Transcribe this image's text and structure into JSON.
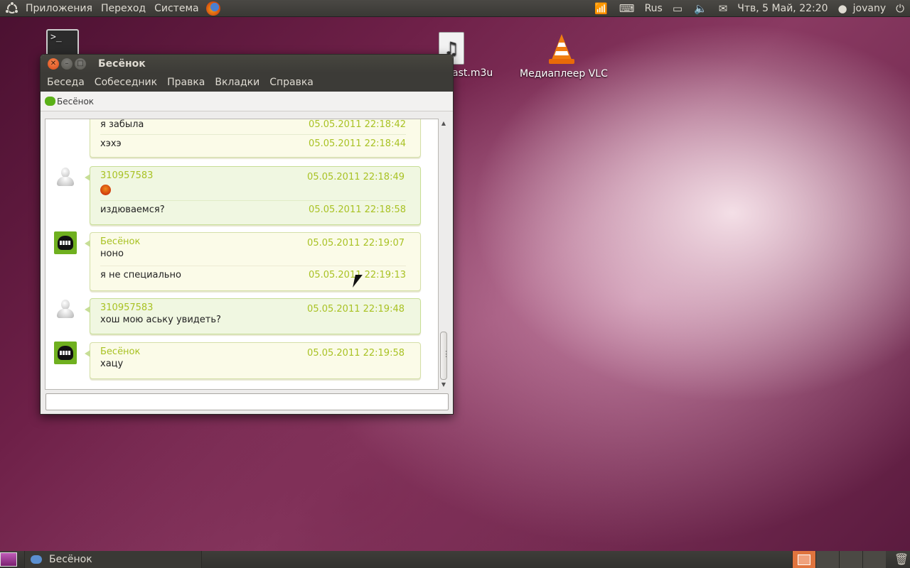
{
  "top_panel": {
    "menus": [
      "Приложения",
      "Переход",
      "Система"
    ],
    "keyboard_layout": "Rus",
    "datetime": "Чтв,  5 Май, 22:20",
    "user": "jovany"
  },
  "desktop": {
    "icons": [
      {
        "label": "",
        "icon": "terminal-icon"
      },
      {
        "label": "ast.m3u",
        "icon": "music-file-icon"
      },
      {
        "label": "Медиаплеер VLC",
        "icon": "vlc-cone-icon"
      }
    ]
  },
  "window": {
    "title": "Бесёнок",
    "menu": [
      "Беседа",
      "Собеседник",
      "Правка",
      "Вкладки",
      "Справка"
    ],
    "tab_label": "Бесёнок"
  },
  "conversation": [
    {
      "sender": "",
      "messages": [
        {
          "text": "я забыла",
          "time": "05.05.2011 22:18:42"
        },
        {
          "text": "хэхэ",
          "time": "05.05.2011 22:18:44"
        }
      ]
    },
    {
      "sender": "310957583",
      "header_time": "05.05.2011 22:18:49",
      "first": "",
      "messages": [
        {
          "text": "издюваемся?",
          "time": "05.05.2011 22:18:58"
        }
      ]
    },
    {
      "sender": "Бесёнок",
      "header_time": "05.05.2011 22:19:07",
      "first": "ноно",
      "messages": [
        {
          "text": "я не специально",
          "time": "05.05.2011 22:19:13"
        }
      ]
    },
    {
      "sender": "310957583",
      "header_time": "05.05.2011 22:19:48",
      "first": "хош мою аську увидеть?"
    },
    {
      "sender": "Бесёнок",
      "header_time": "05.05.2011 22:19:58",
      "first": "хацу"
    }
  ],
  "input": {
    "value": ""
  },
  "taskbar": {
    "task": "Бесёнок"
  }
}
